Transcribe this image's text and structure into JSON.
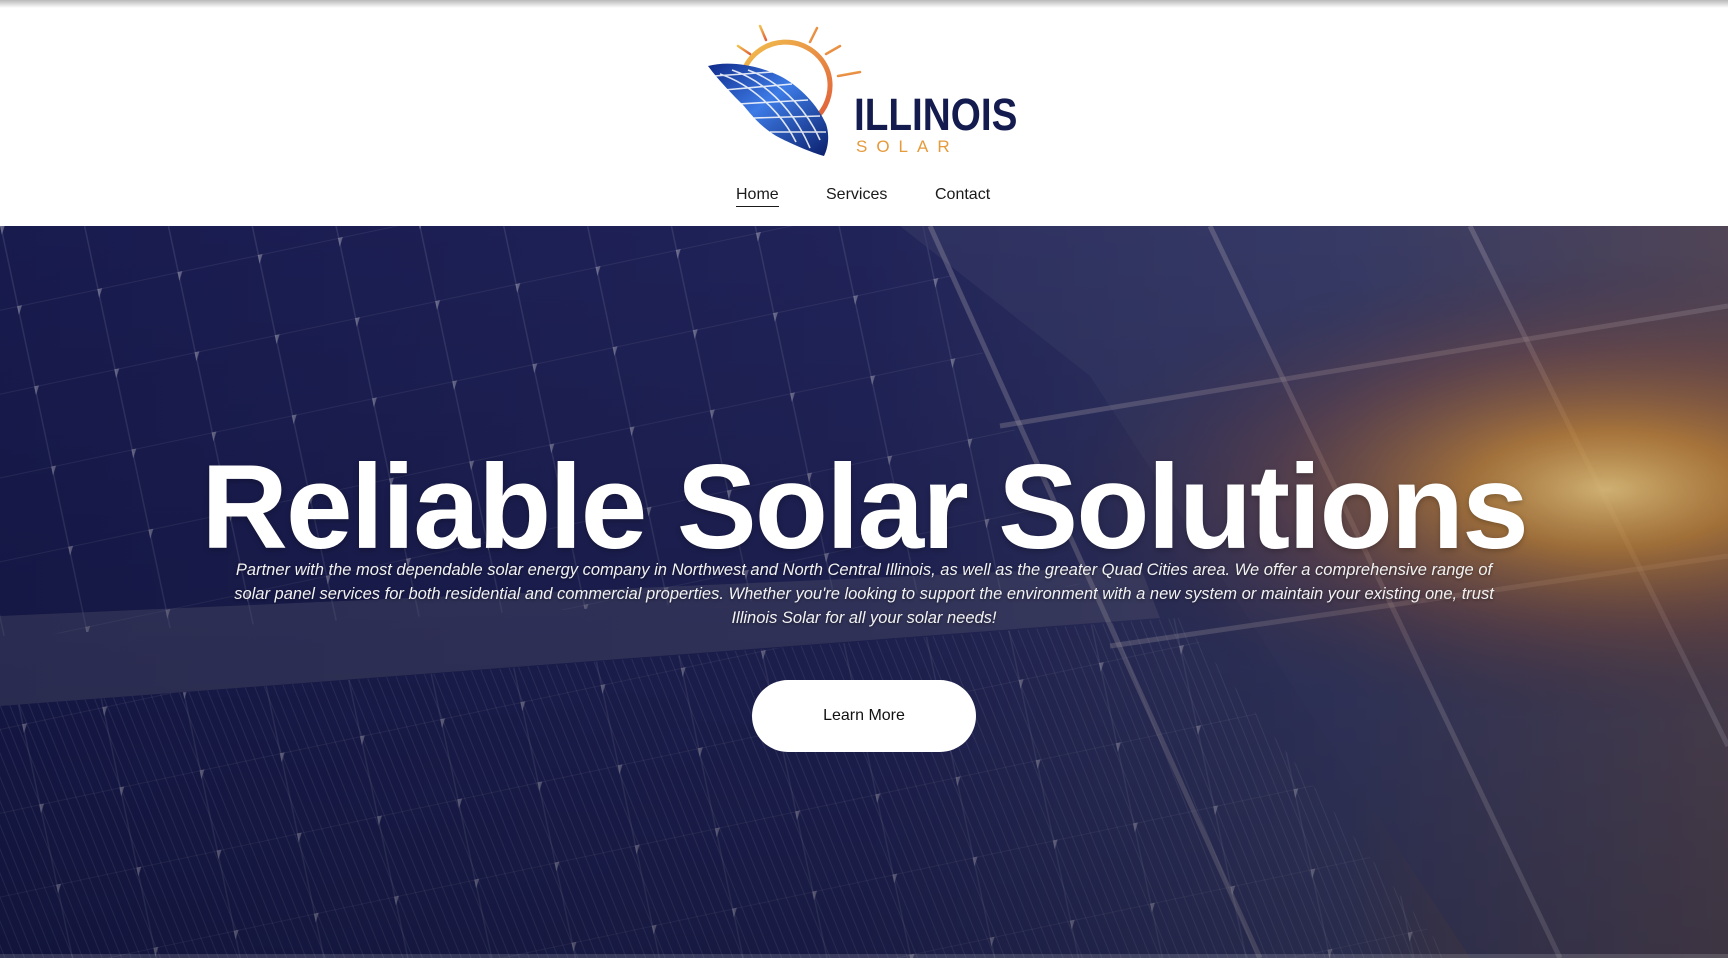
{
  "brand": {
    "name": "ILLINOIS",
    "tagline": "SOLAR",
    "logo_icon": "sun-over-solar-panel-map-icon",
    "colors": {
      "navy": "#141c4f",
      "orange": "#e59a3b",
      "panel_blue": "#2a5bc9"
    }
  },
  "nav": {
    "items": [
      {
        "label": "Home",
        "active": true
      },
      {
        "label": "Services",
        "active": false
      },
      {
        "label": "Contact",
        "active": false
      }
    ]
  },
  "hero": {
    "title": "Reliable Solar Solutions",
    "description": "Partner with the most dependable solar energy company in Northwest and North Central Illinois, as well as the greater Quad Cities area. We offer a comprehensive range of solar panel services for both residential and commercial properties. Whether you're looking to support the environment with a new system or maintain your existing one, trust Illinois Solar for all your solar needs!",
    "cta_label": "Learn More",
    "background": "blurred-solar-panels-sunset-photo"
  }
}
